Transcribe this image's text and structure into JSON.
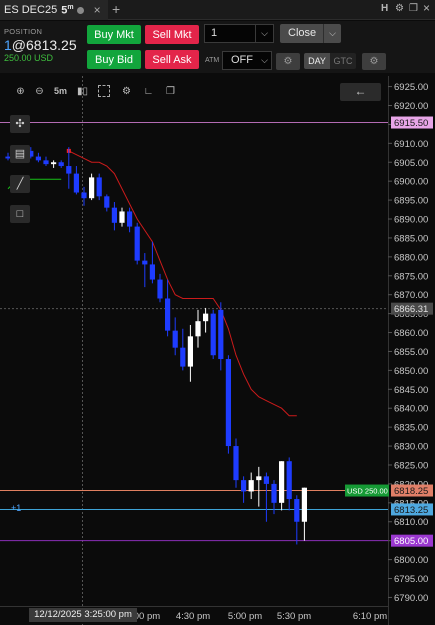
{
  "tab": {
    "symbol": "ES DEC25",
    "timeframe_num": "5",
    "timeframe_unit": "m",
    "close_glyph": "×",
    "add_glyph": "+"
  },
  "toolbar_icons": {
    "h": "H",
    "gear": "⚙",
    "restore": "❐",
    "close": "×"
  },
  "position": {
    "label": "POSITION",
    "qty": "1",
    "price": "@6813.25",
    "pnl": "250.00 USD"
  },
  "orders": {
    "buy_mkt": "Buy Mkt",
    "sell_mkt": "Sell Mkt",
    "buy_bid": "Buy Bid",
    "sell_ask": "Sell Ask",
    "quantity": "1",
    "close": "Close",
    "atm_label": "ATM",
    "atm_value": "OFF",
    "tif_day": "DAY",
    "tif_gtc": "GTC"
  },
  "chart_tools": {
    "zoom_in": "search-plus-icon",
    "zoom_out": "search-minus-icon",
    "timeframe": "5m",
    "bar_type": "candles-icon",
    "select": "selection-icon",
    "settings": "gear-icon",
    "indicators": "indicators-icon",
    "template": "template-icon",
    "back": "←"
  },
  "colors": {
    "up_candle": "#ffffff",
    "down_candle": "#1e3cff",
    "stop_line": "#cc1b1b",
    "green_line": "#18c218",
    "line_6915": "#b36bb3",
    "line_6818": "#e08060",
    "line_6813": "#3ea3d6",
    "line_6805": "#8a2fb8"
  },
  "price_labels": {
    "p1": {
      "text": "6915.50",
      "color": "#e8a6e8"
    },
    "p2": {
      "text": "6866.31",
      "color": "#4a4a4a"
    },
    "p3": {
      "text": "6818.25",
      "color": "#e07f68"
    },
    "p4": {
      "text": "6813.25",
      "color": "#4ea8df"
    },
    "p5": {
      "text": "6805.00",
      "color": "#9b38d0"
    }
  },
  "pnl_tag": "USD 250.00",
  "position_marker": "+1",
  "time_tag": "12/12/2025 3:25:00 pm",
  "chart_data": {
    "type": "candlestick",
    "instrument": "ES DEC25",
    "timeframe": "5m",
    "y_ticks": [
      "6925.00",
      "6920.00",
      "6915.00",
      "6910.00",
      "6905.00",
      "6900.00",
      "6895.00",
      "6890.00",
      "6885.00",
      "6880.00",
      "6875.00",
      "6870.00",
      "6865.00",
      "6860.00",
      "6855.00",
      "6850.00",
      "6845.00",
      "6840.00",
      "6835.00",
      "6830.00",
      "6825.00",
      "6820.00",
      "6815.00",
      "6810.00",
      "6805.00",
      "6800.00",
      "6795.00",
      "6790.00"
    ],
    "ylim": [
      6788,
      6927
    ],
    "x_ticks": [
      "4:00 pm",
      "4:30 pm",
      "5:00 pm",
      "5:30 pm",
      "6:10 pm"
    ],
    "candles": [
      {
        "o": 6906.5,
        "h": 6907.5,
        "l": 6905.5,
        "c": 6906.0
      },
      {
        "o": 6906.0,
        "h": 6908.0,
        "l": 6905.0,
        "c": 6907.0
      },
      {
        "o": 6907.0,
        "h": 6909.0,
        "l": 6905.5,
        "c": 6908.0
      },
      {
        "o": 6908.0,
        "h": 6909.0,
        "l": 6906.0,
        "c": 6906.5
      },
      {
        "o": 6906.5,
        "h": 6907.5,
        "l": 6905.0,
        "c": 6905.5
      },
      {
        "o": 6905.5,
        "h": 6906.5,
        "l": 6904.0,
        "c": 6904.5
      },
      {
        "o": 6904.5,
        "h": 6905.5,
        "l": 6903.5,
        "c": 6905.0
      },
      {
        "o": 6905.0,
        "h": 6905.5,
        "l": 6903.5,
        "c": 6904.0
      },
      {
        "o": 6904.0,
        "h": 6909.0,
        "l": 6898.0,
        "c": 6902.0
      },
      {
        "o": 6902.0,
        "h": 6904.0,
        "l": 6896.5,
        "c": 6897.0
      },
      {
        "o": 6897.0,
        "h": 6898.5,
        "l": 6893.5,
        "c": 6895.5
      },
      {
        "o": 6895.5,
        "h": 6902.0,
        "l": 6895.0,
        "c": 6901.0
      },
      {
        "o": 6901.0,
        "h": 6902.0,
        "l": 6895.0,
        "c": 6896.0
      },
      {
        "o": 6896.0,
        "h": 6896.5,
        "l": 6892.0,
        "c": 6893.0
      },
      {
        "o": 6893.0,
        "h": 6894.5,
        "l": 6887.0,
        "c": 6889.0
      },
      {
        "o": 6889.0,
        "h": 6893.0,
        "l": 6888.0,
        "c": 6892.0
      },
      {
        "o": 6892.0,
        "h": 6893.0,
        "l": 6886.5,
        "c": 6888.0
      },
      {
        "o": 6888.0,
        "h": 6889.0,
        "l": 6878.0,
        "c": 6879.0
      },
      {
        "o": 6879.0,
        "h": 6881.0,
        "l": 6872.0,
        "c": 6878.0
      },
      {
        "o": 6878.0,
        "h": 6884.0,
        "l": 6873.0,
        "c": 6874.0
      },
      {
        "o": 6874.0,
        "h": 6875.5,
        "l": 6868.0,
        "c": 6869.0
      },
      {
        "o": 6869.0,
        "h": 6874.0,
        "l": 6859.0,
        "c": 6860.5
      },
      {
        "o": 6860.5,
        "h": 6864.0,
        "l": 6854.0,
        "c": 6856.0
      },
      {
        "o": 6856.0,
        "h": 6861.0,
        "l": 6850.0,
        "c": 6851.0
      },
      {
        "o": 6851.0,
        "h": 6862.0,
        "l": 6847.0,
        "c": 6859.0
      },
      {
        "o": 6859.0,
        "h": 6866.0,
        "l": 6856.0,
        "c": 6863.0
      },
      {
        "o": 6863.0,
        "h": 6866.5,
        "l": 6860.0,
        "c": 6865.0
      },
      {
        "o": 6865.0,
        "h": 6866.0,
        "l": 6853.0,
        "c": 6854.0
      },
      {
        "o": 6866.0,
        "h": 6868.0,
        "l": 6850.0,
        "c": 6853.0
      },
      {
        "o": 6853.0,
        "h": 6854.0,
        "l": 6828.0,
        "c": 6830.0
      },
      {
        "o": 6830.0,
        "h": 6832.0,
        "l": 6819.0,
        "c": 6821.0
      },
      {
        "o": 6821.0,
        "h": 6822.0,
        "l": 6815.0,
        "c": 6818.0
      },
      {
        "o": 6818.0,
        "h": 6823.0,
        "l": 6816.0,
        "c": 6821.0
      },
      {
        "o": 6821.0,
        "h": 6824.5,
        "l": 6814.0,
        "c": 6822.0
      },
      {
        "o": 6822.0,
        "h": 6823.0,
        "l": 6810.0,
        "c": 6820.0
      },
      {
        "o": 6820.0,
        "h": 6821.0,
        "l": 6812.0,
        "c": 6815.0
      },
      {
        "o": 6815.0,
        "h": 6826.0,
        "l": 6813.0,
        "c": 6826.0
      },
      {
        "o": 6826.0,
        "h": 6827.0,
        "l": 6813.0,
        "c": 6816.0
      },
      {
        "o": 6816.0,
        "h": 6817.0,
        "l": 6804.0,
        "c": 6810.0
      },
      {
        "o": 6810.0,
        "h": 6819.0,
        "l": 6805.0,
        "c": 6819.0
      }
    ],
    "stop_line": [
      [
        8,
        6908
      ],
      [
        9,
        6907
      ],
      [
        10,
        6906
      ],
      [
        11,
        6905
      ],
      [
        12,
        6905
      ],
      [
        13,
        6904
      ],
      [
        14,
        6902
      ],
      [
        15,
        6898
      ],
      [
        16,
        6894
      ],
      [
        17,
        6890
      ],
      [
        18,
        6887
      ],
      [
        19,
        6884
      ],
      [
        20,
        6879
      ],
      [
        21,
        6874
      ],
      [
        22,
        6870
      ],
      [
        23,
        6869
      ],
      [
        24,
        6869
      ],
      [
        25,
        6869
      ],
      [
        26,
        6869
      ],
      [
        27,
        6869
      ],
      [
        28,
        6866
      ],
      [
        29,
        6861
      ],
      [
        30,
        6854
      ],
      [
        31,
        6849
      ],
      [
        32,
        6845
      ],
      [
        33,
        6843
      ],
      [
        34,
        6842
      ],
      [
        35,
        6841
      ],
      [
        36,
        6840
      ],
      [
        37,
        6838
      ],
      [
        38,
        6838
      ]
    ],
    "green_line": [
      [
        0,
        6898
      ],
      [
        1,
        6900
      ],
      [
        2,
        6900.5
      ],
      [
        3,
        6900.5
      ],
      [
        4,
        6900.5
      ],
      [
        5,
        6900.5
      ],
      [
        6,
        6900.5
      ],
      [
        7,
        6900.5
      ]
    ],
    "price_lines": [
      6915.5,
      6866.31,
      6818.25,
      6813.25,
      6805.0
    ]
  }
}
